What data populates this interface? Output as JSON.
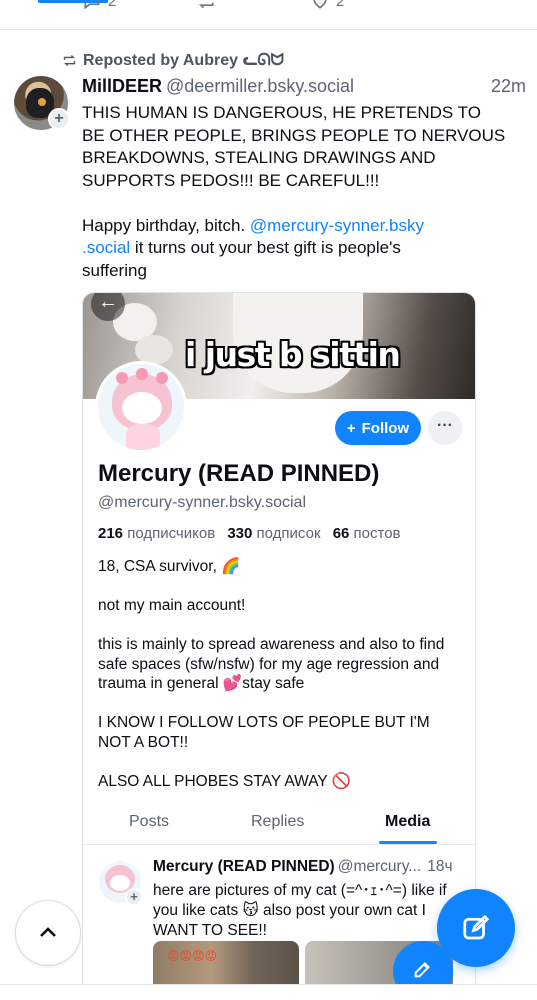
{
  "top_actions": {
    "reply_count": "2",
    "like_count": "2"
  },
  "repost": {
    "label": "Reposted by Aubrey ᓚᘏᗢ"
  },
  "post": {
    "author_name": "MillDEER",
    "author_handle": "@deermiller.bsky.social",
    "time": "22m",
    "text_lines": [
      "THIS HUMAN IS DANGEROUS, HE PRETENDS TO",
      "BE OTHER PEOPLE, BRINGS PEOPLE TO NERVOUS",
      "BREAKDOWNS, STEALING DRAWINGS AND",
      "SUPPORTS PEDOS!!! BE CAREFUL!!!"
    ],
    "text2_prefix": "Happy birthday, bitch. ",
    "mention_line1": "@mercury-synner.bsky",
    "mention_line2": ".social",
    "text2_suffix": " it turns out your best gift is people's",
    "text2_last": "suffering"
  },
  "embed": {
    "banner_caption": "i just b sittin",
    "follow_label": "Follow",
    "more_label": "···",
    "profile_name": "Mercury (READ PINNED)",
    "profile_handle": "@mercury-synner.bsky.social",
    "stats": {
      "followers_count": "216",
      "followers_label": "подписчиков",
      "following_count": "330",
      "following_label": "подписок",
      "posts_count": "66",
      "posts_label": "постов"
    },
    "bio": [
      "18, CSA survivor, 🌈",
      "not my main account!",
      "this is mainly to spread awareness and also to find safe spaces (sfw/nsfw) for my age regression and trauma in general 💕stay safe",
      "I KNOW I FOLLOW LOTS OF PEOPLE BUT I'M NOT A BOT!!",
      "ALSO ALL PHOBES STAY AWAY 🚫"
    ],
    "tabs": [
      "Posts",
      "Replies",
      "Media"
    ],
    "active_tab": "Media",
    "inner_post": {
      "name": "Mercury (READ PINNED)",
      "handle": "@mercury...",
      "time": "18ч",
      "text": "here are pictures of my cat (=^･ｪ･^=) like if you like cats 😽 also post your own cat I WANT TO SEE!!",
      "image_emoji": "😡😡😡😡"
    }
  },
  "colors": {
    "accent": "#1083fe",
    "muted": "#5b6573",
    "text": "#0b0f14"
  },
  "icons": {
    "repost": "repost-icon",
    "scroll_top": "chevron-up-icon",
    "compose": "compose-icon"
  }
}
